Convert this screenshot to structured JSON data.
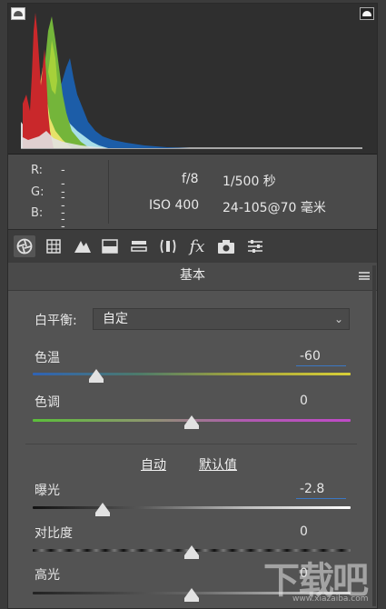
{
  "histogram": {
    "colors": {
      "red": "#c8282b",
      "green": "#7ab83a",
      "yellow": "#e8e36a",
      "cyan": "#a6dde6",
      "blue": "#1c5da8",
      "white": "#dadada"
    }
  },
  "info": {
    "r_label": "R:",
    "g_label": "G:",
    "b_label": "B:",
    "r_value": "---",
    "g_value": "---",
    "b_value": "---",
    "aperture": "f/8",
    "shutter": "1/500 秒",
    "iso": "ISO 400",
    "lens": "24-105@70 毫米"
  },
  "toolbar": {
    "icons": [
      "aperture-icon",
      "grid-icon",
      "mountain-icon",
      "split-toning-icon",
      "lens-icon",
      "fx-icon",
      "camera-icon",
      "sliders-icon"
    ],
    "fx_text": "fx"
  },
  "panel": {
    "title": "基本",
    "wb_label": "白平衡:",
    "wb_value": "自定",
    "temp_label": "色温",
    "temp_value": "-60",
    "temp_level": 0.2,
    "tint_label": "色调",
    "tint_value": "0",
    "tint_level": 0.5,
    "auto_label": "自动",
    "default_label": "默认值",
    "exposure_label": "曝光",
    "exposure_value": "-2.8",
    "exposure_level": 0.22,
    "contrast_label": "对比度",
    "contrast_value": "0",
    "contrast_level": 0.5,
    "highlights_label": "高光",
    "highlights_value": "0",
    "highlights_level": 0.5
  },
  "watermark": {
    "text": "下载吧",
    "url": "www.xiazaiba.com"
  }
}
